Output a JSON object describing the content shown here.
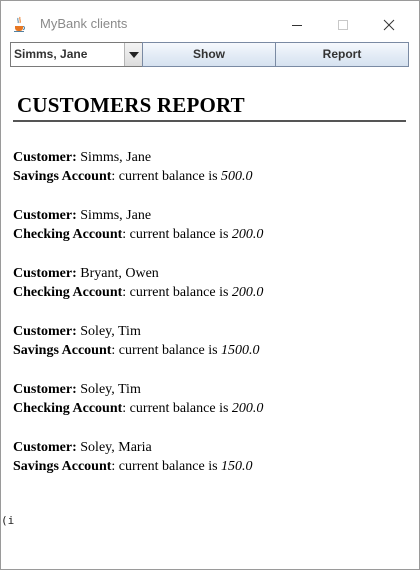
{
  "window": {
    "title": "MyBank clients"
  },
  "toolbar": {
    "customer_selected": "Simms, Jane",
    "show_label": "Show",
    "report_label": "Report"
  },
  "report": {
    "title": "CUSTOMERS REPORT",
    "customer_label": "Customer:",
    "balance_phrase": ": current balance is",
    "entries": [
      {
        "customer": "Simms, Jane",
        "account_type": "Savings Account",
        "balance": "500.0"
      },
      {
        "customer": "Simms, Jane",
        "account_type": "Checking Account",
        "balance": "200.0"
      },
      {
        "customer": "Bryant, Owen",
        "account_type": "Checking Account",
        "balance": "200.0"
      },
      {
        "customer": "Soley, Tim",
        "account_type": "Savings Account",
        "balance": "1500.0"
      },
      {
        "customer": "Soley, Tim",
        "account_type": "Checking Account",
        "balance": "200.0"
      },
      {
        "customer": "Soley, Maria",
        "account_type": "Savings Account",
        "balance": "150.0"
      }
    ],
    "stray_text": "(i"
  },
  "icons": {
    "app": "java-coffee-cup-icon",
    "minimize": "minimize-icon",
    "maximize": "maximize-icon",
    "close": "close-icon",
    "dropdown": "triangle-down-icon"
  }
}
